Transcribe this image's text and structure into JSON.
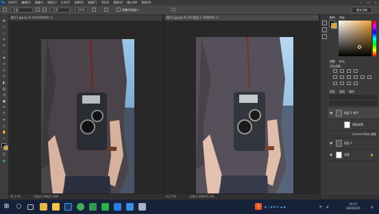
{
  "app": {
    "logo": "Ps"
  },
  "menubar": {
    "items": [
      "文件(F)",
      "编辑(E)",
      "图像(I)",
      "图层(L)",
      "文字(Y)",
      "选择(S)",
      "滤镜(T)",
      "3D(D)",
      "视图(V)",
      "窗口(W)",
      "帮助(H)"
    ],
    "window_buttons": [
      "—",
      "□",
      "✕"
    ]
  },
  "options": {
    "size_value": "主要",
    "zoom_value": "100%",
    "checkbox_label": "调整所有窗口",
    "mode_value": "正常",
    "essentials": "基本功能"
  },
  "tabs": [
    {
      "label": "照片1.jpg @ 41.2%(RGB/8#) ✕"
    },
    {
      "label": "照片2.jpg @ 41.2%(图层 1, RGB/8#) ✕"
    }
  ],
  "status": {
    "left_zoom": "41.17%",
    "left_doc": "文档:5.49M/5.49M",
    "right_zoom": "41.17%",
    "right_doc": "文档:5.49M/16.5M"
  },
  "panels": {
    "color_tabs": [
      "颜色",
      "色板"
    ],
    "adjust_tabs": [
      "调整",
      "样式"
    ],
    "adjust_title": "添加调整",
    "layers_tabs": [
      "图层",
      "通道",
      "路径"
    ],
    "layers": [
      {
        "name": "图层 1 拷贝",
        "sub": "智能滤镜"
      },
      {
        "name": "Camera Raw 滤镜"
      },
      {
        "name": "图层 1"
      },
      {
        "name": "背景"
      }
    ]
  },
  "taskbar": {
    "time": "10:17",
    "date": "2020/2/25",
    "lang": "中",
    "ime": "S"
  },
  "colors": {
    "menubar": "#3a3a3a",
    "options": "#474747",
    "canvas_bg": "#282828",
    "panel": "#3a3a3a",
    "taskbar": "#17223a",
    "ps_blue": "#31a8ff"
  }
}
